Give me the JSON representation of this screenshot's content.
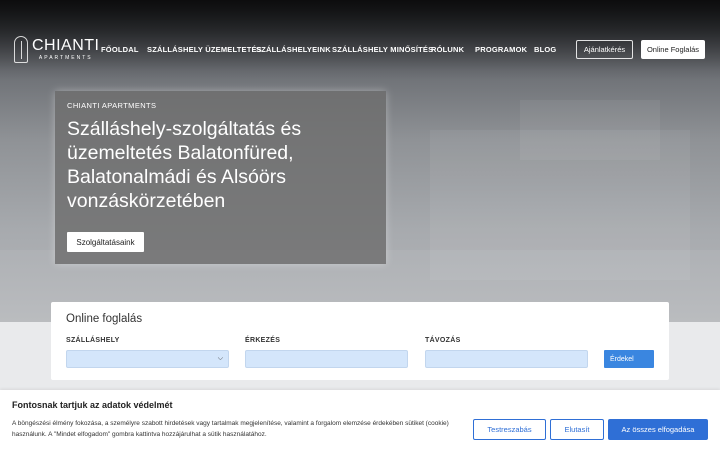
{
  "brand": {
    "name": "CHIANTI",
    "sub": "APARTMENTS"
  },
  "nav": [
    {
      "label": "FŐOLDAL"
    },
    {
      "label": "SZÁLLÁSHELY ÜZEMELTETÉS"
    },
    {
      "label": "SZÁLLÁSHELYEINK"
    },
    {
      "label": "SZÁLLÁSHELY MINŐSÍTÉS"
    },
    {
      "label": "RÓLUNK"
    },
    {
      "label": "PROGRAMOK"
    },
    {
      "label": "BLOG"
    }
  ],
  "header_buttons": {
    "quote": "Ajánlatkérés",
    "booking": "Online Foglalás"
  },
  "hero": {
    "eyebrow": "CHIANTI APARTMENTS",
    "title": "Szálláshely-szolgáltatás és üzemeltetés Balatonfüred, Balatonalmádi és Alsóörs vonzáskörzetében",
    "button": "Szolgáltatásaink"
  },
  "booking": {
    "title": "Online foglalás",
    "accommodation_label": "SZÁLLÁSHELY",
    "arrival_label": "ÉRKEZÉS",
    "departure_label": "TÁVOZÁS",
    "search_button": "Érdekel"
  },
  "cookie": {
    "title": "Fontosnak tartjuk az adatok védelmét",
    "text": "A böngészési élmény fokozása, a személyre szabott hirdetések vagy tartalmak megjelenítése, valamint a forgalom elemzése érdekében sütiket (cookie) használunk. A \"Mindet elfogadom\" gombra kattintva hozzájárulhat a sütik használatához.",
    "customize": "Testreszabás",
    "reject": "Elutasít",
    "accept_all": "Az összes elfogadása"
  },
  "colors": {
    "accent": "#2f6fd6",
    "field_bg": "#d4e6fb",
    "search_btn": "#3a86e0"
  },
  "icons": {
    "select_caret": "chevron-down-icon",
    "logo": "logo-mark-icon"
  }
}
